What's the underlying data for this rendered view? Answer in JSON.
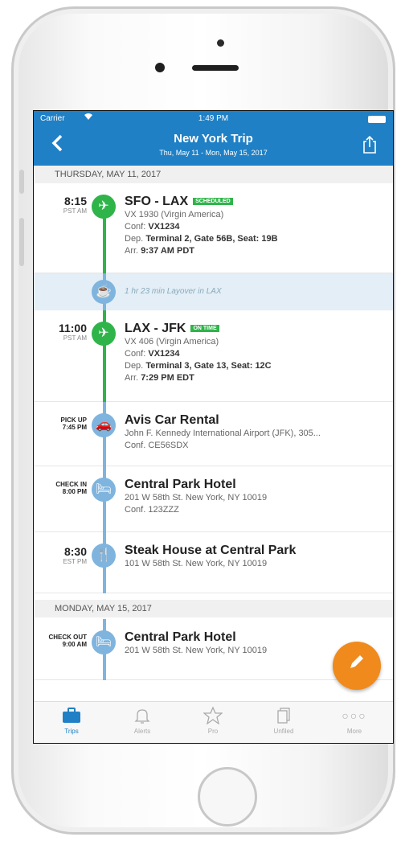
{
  "status": {
    "carrier": "Carrier",
    "time": "1:49 PM"
  },
  "header": {
    "title": "New York Trip",
    "subtitle": "Thu, May 11 - Mon, May 15, 2017"
  },
  "days": [
    {
      "label": "THURSDAY, MAY 11, 2017"
    },
    {
      "label": "MONDAY, MAY 15, 2017"
    }
  ],
  "items": [
    {
      "time": "8:15",
      "tz": "PST",
      "ampm": "AM",
      "title": "SFO - LAX",
      "badge": "SCHEDULED",
      "line1": "VX 1930 (Virgin America)",
      "conf_label": "Conf:",
      "conf": "VX1234",
      "dep_label": "Dep.",
      "dep": "Terminal 2, Gate 56B, Seat: 19B",
      "arr_label": "Arr.",
      "arr": "9:37 AM PDT"
    },
    {
      "layover": "1 hr 23 min Layover in LAX"
    },
    {
      "time": "11:00",
      "tz": "PST",
      "ampm": "AM",
      "title": "LAX - JFK",
      "badge": "ON TIME",
      "line1": "VX 406 (Virgin America)",
      "conf_label": "Conf:",
      "conf": "VX1234",
      "dep_label": "Dep.",
      "dep": "Terminal 3, Gate 13, Seat: 12C",
      "arr_label": "Arr.",
      "arr": "7:29 PM EDT"
    },
    {
      "time_label": "PICK UP",
      "time": "7:45 PM",
      "title": "Avis Car Rental",
      "line1": "John F. Kennedy International Airport (JFK), 305...",
      "line2": "Conf. CE56SDX"
    },
    {
      "time_label": "CHECK IN",
      "time": "8:00 PM",
      "title": "Central Park Hotel",
      "line1": "201 W 58th St. New York, NY 10019",
      "line2": "Conf. 123ZZZ"
    },
    {
      "time": "8:30",
      "tz": "EST",
      "ampm": "PM",
      "title": "Steak House at Central Park",
      "line1": "101 W 58th St. New York, NY 10019"
    },
    {
      "time_label": "CHECK OUT",
      "time": "9:00 AM",
      "title": "Central Park Hotel",
      "line1": "201 W 58th St. New York, NY 10019"
    }
  ],
  "tabs": [
    {
      "label": "Trips",
      "icon": "briefcase-icon",
      "active": true
    },
    {
      "label": "Alerts",
      "icon": "bell-icon"
    },
    {
      "label": "Pro",
      "icon": "star-icon"
    },
    {
      "label": "Unfiled",
      "icon": "documents-icon"
    },
    {
      "label": "More",
      "icon": "more-dots-icon"
    }
  ],
  "colors": {
    "header": "#1f80c6",
    "flight_green": "#2fb44a",
    "rail_blue": "#7fb4de",
    "fab_orange": "#f08a1c"
  }
}
